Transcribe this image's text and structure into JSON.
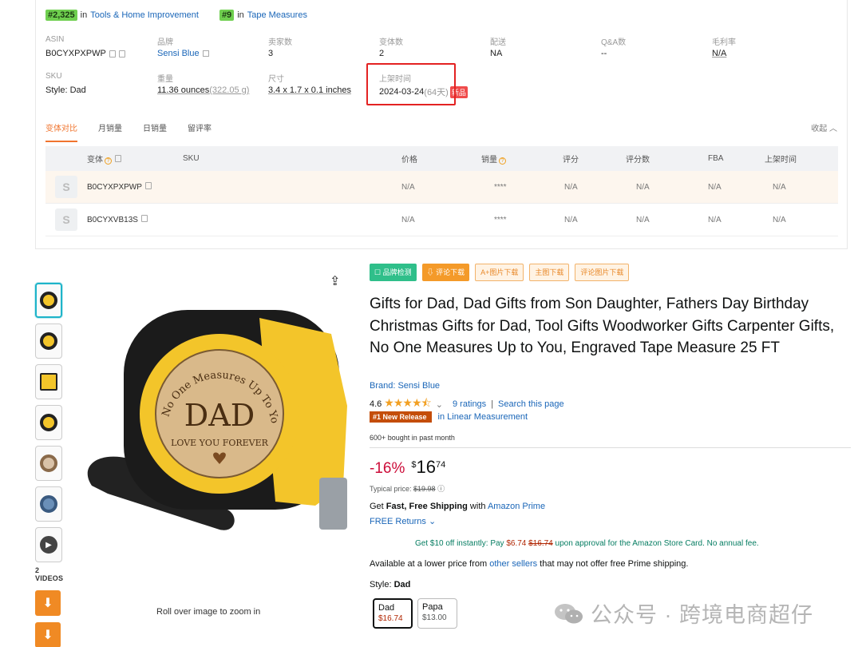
{
  "ranks": [
    {
      "rank": "#2,325",
      "in": "in",
      "category": "Tools & Home Improvement"
    },
    {
      "rank": "#9",
      "in": "in",
      "category": "Tape Measures"
    }
  ],
  "info_row1": [
    {
      "label": "ASIN",
      "value": "B0CYXPXPWP"
    },
    {
      "label": "品牌",
      "value": "Sensi Blue"
    },
    {
      "label": "卖家数",
      "value": "3"
    },
    {
      "label": "变体数",
      "value": "2"
    },
    {
      "label": "配送",
      "value": "NA"
    },
    {
      "label": "Q&A数",
      "value": "--"
    },
    {
      "label": "毛利率",
      "value": "N/A"
    }
  ],
  "info_row2": {
    "sku": {
      "label": "SKU",
      "value": "Style: Dad"
    },
    "weight": {
      "label": "重量",
      "value": "11.36 ounces",
      "extra": "(322.05 g)"
    },
    "size": {
      "label": "尺寸",
      "value": "3.4 x 1.7 x 0.1 inches"
    },
    "launch": {
      "label": "上架时间",
      "value": "2024-03-24",
      "extra": "(64天)",
      "tag": "新品"
    }
  },
  "tabs": [
    "变体对比",
    "月销量",
    "日销量",
    "留评率"
  ],
  "collapse_label": "收起",
  "collapse_icon": "chevron-up-icon",
  "variant_table": {
    "headers": [
      "变体",
      "SKU",
      "价格",
      "销量",
      "评分",
      "评分数",
      "FBA",
      "上架时间"
    ],
    "rows": [
      {
        "asin": "B0CYXPXPWP",
        "sku": "",
        "price": "N/A",
        "sales": "****",
        "rating": "N/A",
        "rating_count": "N/A",
        "fba": "N/A",
        "launch": "N/A"
      },
      {
        "asin": "B0CYXVB13S",
        "sku": "",
        "price": "N/A",
        "sales": "****",
        "rating": "N/A",
        "rating_count": "N/A",
        "fba": "N/A",
        "launch": "N/A"
      }
    ],
    "thumb_letter": "S"
  },
  "plugin_buttons": [
    "品牌检测",
    "评论下载",
    "A+图片下载",
    "主图下载",
    "评论图片下载"
  ],
  "product": {
    "title": "Gifts for Dad, Dad Gifts from Son Daughter, Fathers Day Birthday Christmas Gifts for Dad, Tool Gifts Woodworker Gifts Carpenter Gifts, No One Measures Up to You, Engraved Tape Measure 25 FT",
    "brand": "Brand: Sensi Blue",
    "rating": "4.6",
    "stars": "★★★★⯪",
    "chevron": "⌄",
    "ratings_count": "9 ratings",
    "separator": "|",
    "search_page": "Search this page",
    "new_release_badge": "#1 New Release",
    "new_release_category": "in Linear Measurement",
    "bought": "600+ bought in past month",
    "discount": "-16%",
    "currency": "$",
    "price_whole": "16",
    "price_fraction": "74",
    "typical_label": "Typical price: ",
    "typical_price": "$19.98",
    "shipping_pre": "Get ",
    "shipping_bold": "Fast, Free Shipping",
    "shipping_mid": " with ",
    "shipping_link": "Amazon Prime",
    "free_returns": "FREE Returns",
    "card_offer_pre": "Get $10 off instantly: Pay ",
    "card_offer_price": "$6.74",
    "card_offer_strike": "$16.74",
    "card_offer_post": " upon approval for the Amazon Store Card. No annual fee.",
    "lower_pre": "Available at a lower price from ",
    "lower_link": "other sellers",
    "lower_post": " that may not offer free Prime shipping.",
    "style_label": "Style: ",
    "style_value": "Dad",
    "style_options": [
      {
        "name": "Dad",
        "price": "$16.74"
      },
      {
        "name": "Papa",
        "price": "$13.00"
      }
    ],
    "image_text": {
      "arc": "No One Measures Up To You!",
      "main": "DAD",
      "sub": "LOVE YOU FOREVER"
    },
    "zoom_hint": "Roll over image to zoom in",
    "videos_label": "2 VIDEOS"
  },
  "watermark": "公众号 · 跨境电商超仔",
  "colors": {
    "accent_orange": "#f0752f",
    "link_blue": "#1a66b8",
    "price_red": "#cc0c39",
    "highlight_red": "#e32222",
    "tape_yellow": "#f3c52a"
  }
}
